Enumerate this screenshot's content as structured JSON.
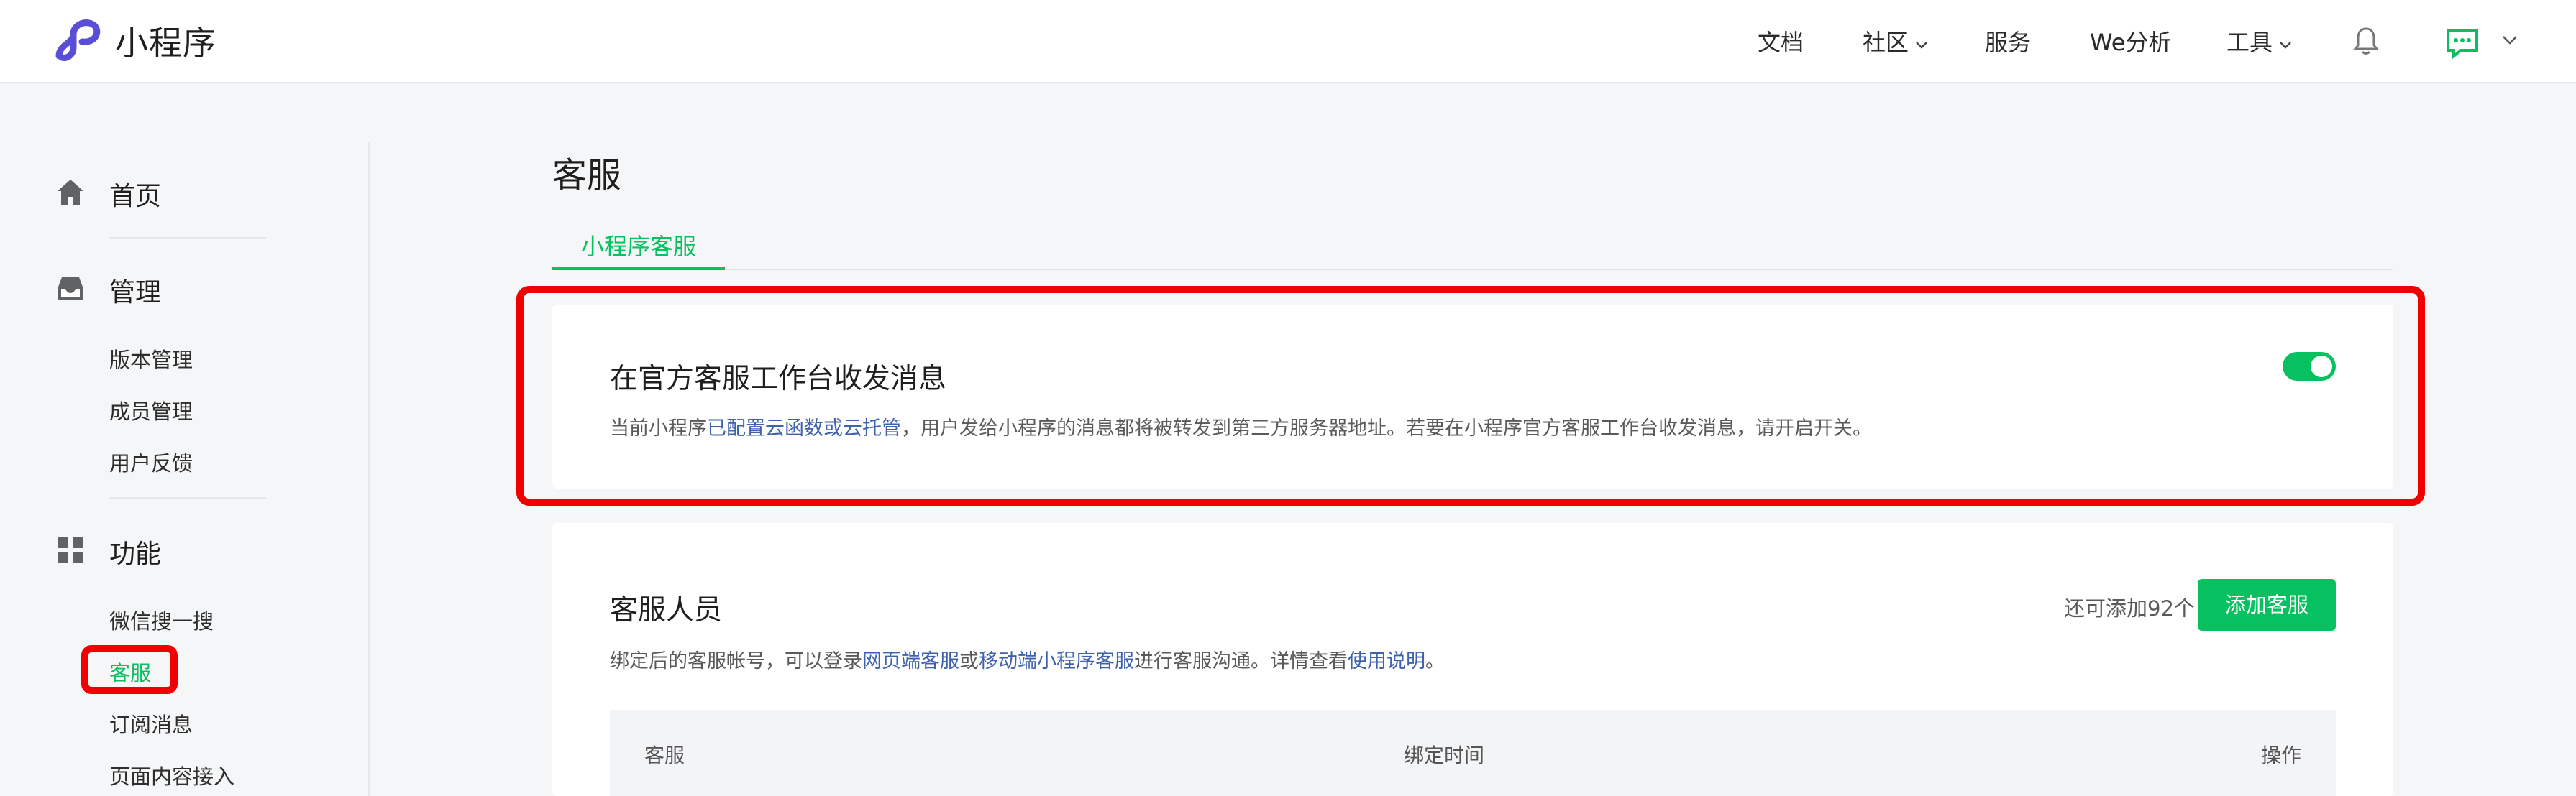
{
  "topbar": {
    "brand": "小程序",
    "nav": [
      {
        "label": "文档"
      },
      {
        "label": "社区"
      },
      {
        "label": "服务"
      },
      {
        "label": "We分析"
      },
      {
        "label": "工具"
      }
    ]
  },
  "sidebar": {
    "sections": [
      {
        "label": "首页",
        "icon": "home-icon"
      },
      {
        "label": "管理",
        "icon": "inbox-icon"
      },
      {
        "label": "功能",
        "icon": "grid-icon"
      }
    ],
    "manage_items": [
      "版本管理",
      "成员管理",
      "用户反馈"
    ],
    "feature_items": [
      "微信搜一搜",
      "客服",
      "订阅消息",
      "页面内容接入"
    ]
  },
  "page": {
    "title": "客服",
    "tab": "小程序客服"
  },
  "official_card": {
    "title": "在官方客服工作台收发消息",
    "desc_before": "当前小程序",
    "desc_link": "已配置云函数或云托管",
    "desc_after": "，用户发给小程序的消息都将被转发到第三方服务器地址。若要在小程序官方客服工作台收发消息，请开启开关。",
    "toggle_on": true
  },
  "staff_card": {
    "title": "客服人员",
    "desc_1": "绑定后的客服帐号，可以登录",
    "link_1": "网页端客服",
    "desc_2": "或",
    "link_2": "移动端小程序客服",
    "desc_3": "进行客服沟通。详情查看",
    "link_3": "使用说明",
    "desc_4": "。",
    "remaining": "还可添加92个",
    "add_button": "添加客服",
    "columns": [
      "客服",
      "绑定时间",
      "操作"
    ]
  },
  "colors": {
    "brand_green": "#07c160",
    "link_blue": "#3e62ad",
    "annotation_red": "#f00000",
    "logo_purple": "#5b4ed6"
  }
}
